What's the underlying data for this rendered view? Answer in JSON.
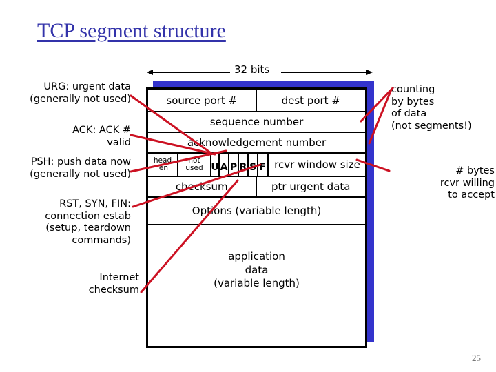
{
  "slide": {
    "title": "TCP segment structure",
    "page_number": "25",
    "accent_color": "#3333aa",
    "shadow_color": "#3333cc",
    "annotation_color": "#cc1122"
  },
  "width_label": "32 bits",
  "left_callouts": [
    {
      "id": "urg",
      "text": "URG: urgent data\n(generally not used)"
    },
    {
      "id": "ack",
      "text": "ACK: ACK #\nvalid"
    },
    {
      "id": "psh",
      "text": "PSH: push data now\n(generally not used)"
    },
    {
      "id": "rst",
      "text": "RST, SYN, FIN:\nconnection estab\n(setup, teardown\ncommands)"
    },
    {
      "id": "cksum",
      "text": "Internet\nchecksum"
    }
  ],
  "right_callouts": [
    {
      "id": "counting",
      "text": "counting\nby bytes\nof data\n(not segments!)"
    },
    {
      "id": "window",
      "text": "# bytes\nrcvr willing\nto accept"
    }
  ],
  "segment": {
    "source_port": "source port #",
    "dest_port": "dest port #",
    "sequence_number": "sequence number",
    "acknowledgement_number": "acknowledgement number",
    "head_len": "head\nlen",
    "not_used": "not\nused",
    "flags": [
      "U",
      "A",
      "P",
      "R",
      "S",
      "F"
    ],
    "rcvr_window_size": "rcvr window size",
    "checksum": "checksum",
    "ptr_urgent_data": "ptr urgent data",
    "options": "Options (variable length)",
    "application_data": "application\ndata\n(variable length)"
  }
}
